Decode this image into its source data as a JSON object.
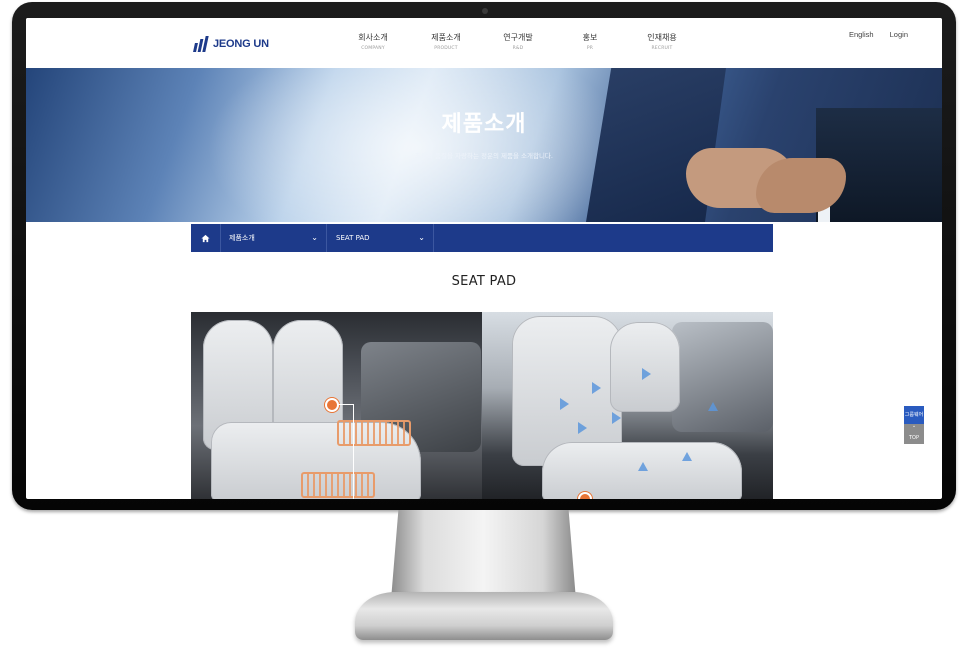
{
  "header": {
    "logo_text": "JEONG UN",
    "nav": [
      {
        "label": "회사소개",
        "sub": "COMPANY"
      },
      {
        "label": "제품소개",
        "sub": "PRODUCT"
      },
      {
        "label": "연구개발",
        "sub": "R&D"
      },
      {
        "label": "홍보",
        "sub": "PR"
      },
      {
        "label": "인재채용",
        "sub": "RECRUIT"
      }
    ],
    "util": {
      "lang": "English",
      "login": "Login"
    }
  },
  "hero": {
    "title": "제품소개",
    "subtitle": "최상의 품질을 자랑하는 정운의 제품을 소개합니다."
  },
  "subnav": {
    "home_icon": "home-icon",
    "category": "제품소개",
    "item": "SEAT PAD",
    "chevron_icon": "chevron-down-icon"
  },
  "content": {
    "title": "SEAT PAD"
  },
  "floating": {
    "blue_label": "그룹웨어",
    "top_label": "TOP",
    "top_icon": "chevron-up-icon"
  },
  "colors": {
    "brand": "#1d3a8a",
    "heat": "#e87536",
    "airflow": "#5c96dc"
  }
}
